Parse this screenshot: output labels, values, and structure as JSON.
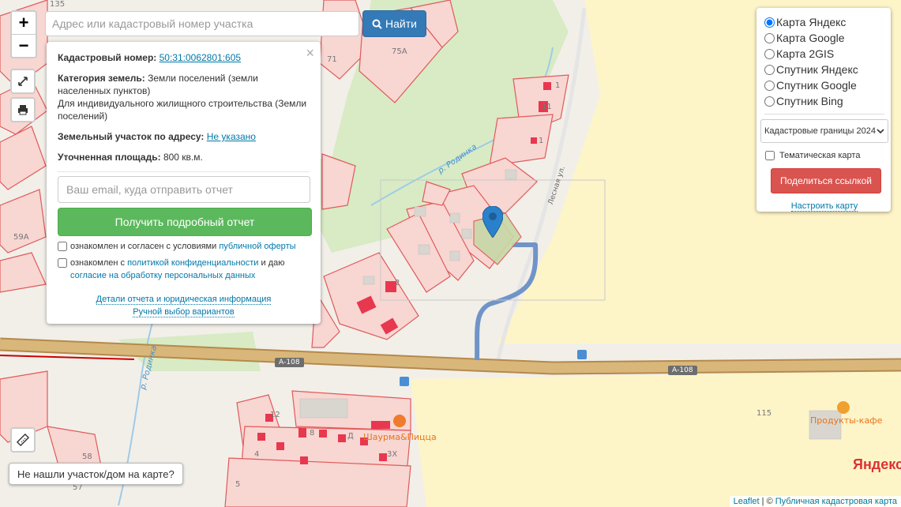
{
  "map": {
    "house_numbers": [
      "135",
      "71",
      "75А",
      "59А",
      "58",
      "57",
      "4",
      "5",
      "3Х",
      "115"
    ],
    "house_extra": [
      "1",
      "11",
      "2",
      "1",
      "12",
      "8",
      "Д"
    ],
    "road_labels": [
      "А-108",
      "А-108"
    ],
    "river_labels": [
      "р. Родинка",
      "р. Родинка"
    ],
    "street_label": "Лесная ул.",
    "poi": [
      "Шаурма&Пицца",
      "Продукты-кафе"
    ],
    "yandex_logo": "Яндекс"
  },
  "controls": {
    "zoom_in": "+",
    "zoom_out": "−"
  },
  "search": {
    "placeholder": "Адрес или кадастровый номер участка",
    "button_label": "Найти"
  },
  "info": {
    "close": "×",
    "cadastral_label": "Кадастровый номер:",
    "cadastral_value": "50:31:0062801:605",
    "category_label": "Категория земель:",
    "category_value": "Земли поселений (земли населенных пунктов)",
    "usage_value": "Для индивидуального жилищного строительства (Земли поселений)",
    "address_label": "Земельный участок по адресу:",
    "address_value": "Не указано",
    "area_label": "Уточненная площадь:",
    "area_value": "800 кв.м.",
    "email_placeholder": "Ваш email, куда отправить отчет",
    "report_button": "Получить подробный отчет",
    "agree1_prefix": "ознакомлен и согласен с условиями",
    "agree1_link": "публичной оферты",
    "agree2_prefix": "ознакомлен с",
    "agree2_link": "политикой конфиденциальности",
    "agree2_mid": "и даю",
    "agree2_link2": "согласие на обработку персональных данных",
    "details_link": "Детали отчета и юридическая информация",
    "manual_link": "Ручной выбор вариантов"
  },
  "layers": {
    "options": [
      "Карта Яндекс",
      "Карта Google",
      "Карта 2GIS",
      "Спутник Яндекс",
      "Спутник Google",
      "Спутник Bing"
    ],
    "selected_index": 0,
    "cadastral_select": "Кадастровые границы 2024",
    "thematic_label": "Тематическая карта",
    "share_button": "Поделиться ссылкой",
    "config_link": "Настроить карту"
  },
  "bottom": {
    "not_found": "Не нашли участок/дом на карте?",
    "attr_leaflet": "Leaflet",
    "attr_sep": " | © ",
    "attr_pkk": "Публичная кадастровая карта"
  },
  "colors": {
    "search_button": "#337ab7",
    "report_button": "#5cb85c",
    "share_button": "#d9534f",
    "link": "#0078a8",
    "marker": "#2a81cb",
    "parcel_border": "#e05a5a",
    "parcel_fill": "#f8d6d2",
    "forest": "#d8ebc4",
    "field": "#fdf4c8",
    "road": "#d9b77a"
  }
}
